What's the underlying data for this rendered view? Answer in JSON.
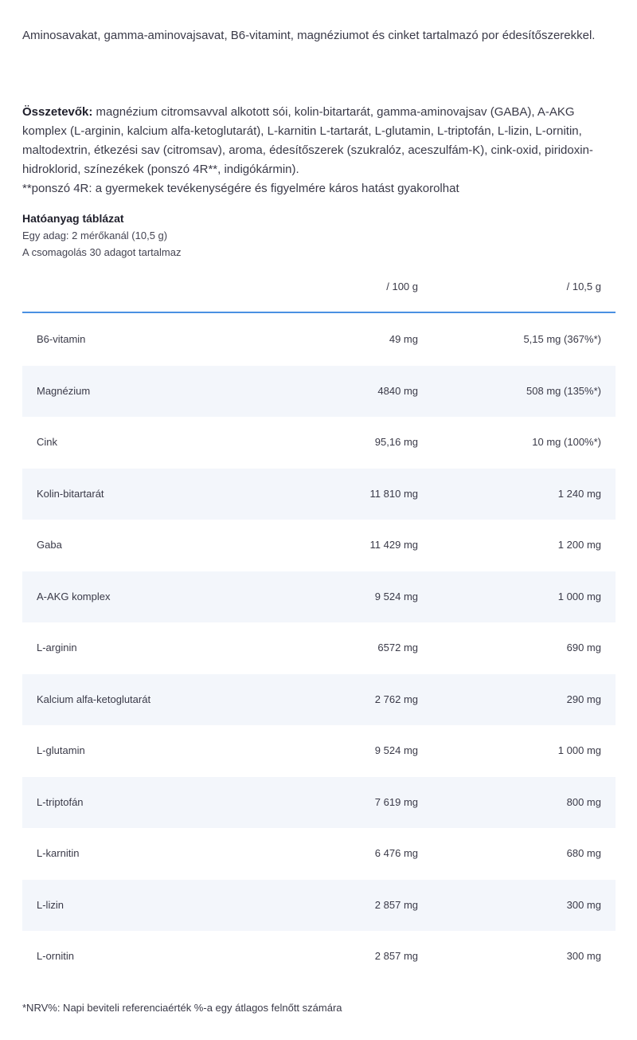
{
  "intro": "Aminosavakat, gamma-aminovajsavat, B6-vitamint, magnéziumot és cinket tartalmazó por édesítőszerekkel.",
  "ingredients": {
    "label": "Összetevők:",
    "text": " magnézium citromsavval alkotott sói, kolin-bitartarát, gamma-aminovajsav (GABA), A-AKG komplex (L-arginin, kalcium alfa-ketoglutarát), L-karnitin L-tartarát, L-glutamin, L-triptofán, L-lizin, L-ornitin, maltodextrin, étkezési sav (citromsav), aroma, édesítőszerek (szukralóz, aceszulfám-K), cink-oxid, piridoxin-hidroklorid, színezékek (ponszó 4R**, indigókármin)."
  },
  "warning": "**ponszó 4R: a gyermekek tevékenységére és figyelmére káros hatást gyakorolhat",
  "table": {
    "title": "Hatóanyag táblázat",
    "serving": "Egy adag: 2 mérőkanál (10,5 g)",
    "package": "A csomagolás 30 adagot tartalmaz",
    "headers": [
      "",
      "/ 100 g",
      "/ 10,5 g"
    ],
    "rows": [
      [
        "B6-vitamin",
        "49 mg",
        "5,15 mg (367%*)"
      ],
      [
        "Magnézium",
        "4840 mg",
        "508 mg (135%*)"
      ],
      [
        "Cink",
        "95,16 mg",
        "10 mg (100%*)"
      ],
      [
        "Kolin-bitartarát",
        "11 810 mg",
        "1 240 mg"
      ],
      [
        "Gaba",
        "11 429 mg",
        "1 200 mg"
      ],
      [
        "A-AKG komplex",
        "9 524 mg",
        "1 000 mg"
      ],
      [
        "L-arginin",
        "6572 mg",
        "690 mg"
      ],
      [
        "Kalcium alfa-ketoglutarát",
        "2 762 mg",
        "290 mg"
      ],
      [
        "L-glutamin",
        "9 524 mg",
        "1 000 mg"
      ],
      [
        "L-triptofán",
        "7 619 mg",
        "800 mg"
      ],
      [
        "L-karnitin",
        "6 476 mg",
        "680 mg"
      ],
      [
        "L-lizin",
        "2 857 mg",
        "300 mg"
      ],
      [
        "L-ornitin",
        "2 857 mg",
        "300 mg"
      ]
    ]
  },
  "footnote": "*NRV%: Napi beviteli referenciaérték %-a egy átlagos felnőtt számára",
  "colors": {
    "accent_line": "#4a90e2",
    "stripe": "#f3f6fb",
    "text": "#3a3a48"
  }
}
